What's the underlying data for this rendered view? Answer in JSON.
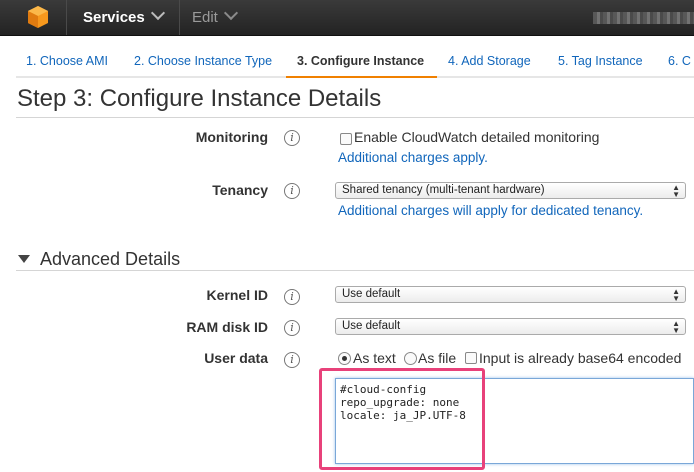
{
  "nav": {
    "services_label": "Services",
    "edit_label": "Edit"
  },
  "wizard": {
    "tabs": [
      {
        "label": "1. Choose AMI"
      },
      {
        "label": "2. Choose Instance Type"
      },
      {
        "label": "3. Configure Instance"
      },
      {
        "label": "4. Add Storage"
      },
      {
        "label": "5. Tag Instance"
      },
      {
        "label": "6. C"
      }
    ],
    "active_index": 2
  },
  "page": {
    "title": "Step 3: Configure Instance Details"
  },
  "monitoring": {
    "label": "Monitoring",
    "checkbox_label": "Enable CloudWatch detailed monitoring",
    "checked": false,
    "note": "Additional charges apply."
  },
  "tenancy": {
    "label": "Tenancy",
    "selected": "Shared tenancy (multi-tenant hardware)",
    "note": "Additional charges will apply for dedicated tenancy."
  },
  "advanced": {
    "heading": "Advanced Details",
    "kernel_id": {
      "label": "Kernel ID",
      "selected": "Use default"
    },
    "ram_disk_id": {
      "label": "RAM disk ID",
      "selected": "Use default"
    },
    "user_data": {
      "label": "User data",
      "radio_text": "As text",
      "radio_file": "As file",
      "selected": "As text",
      "base64_label": "Input is already base64 encoded",
      "base64_checked": false,
      "value": "#cloud-config\nrepo_upgrade: none\nlocale: ja_JP.UTF-8"
    }
  },
  "colors": {
    "link": "#1166bb",
    "active_tab_underline": "#f08000",
    "annotation": "#e8417a",
    "aws_orange": "#f7981d"
  },
  "icons": [
    "aws-logo-icon",
    "chevron-down-icon",
    "info-icon",
    "disclosure-triangle-icon"
  ]
}
